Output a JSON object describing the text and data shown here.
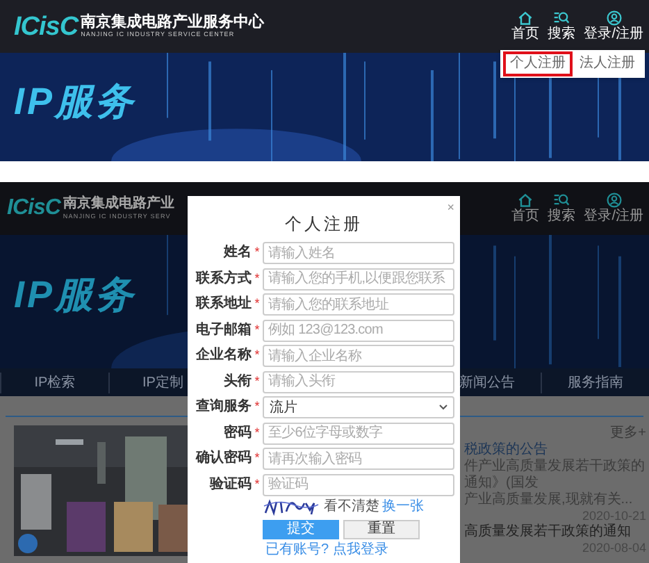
{
  "top_view": {
    "header": {
      "logo_mark": "ICisC",
      "logo_title": "南京集成电路产业服务中心",
      "logo_subtitle": "NANJING IC INDUSTRY SERVICE CENTER",
      "nav": [
        {
          "label": "首页",
          "kind": "home"
        },
        {
          "label": "搜索",
          "kind": "search"
        },
        {
          "label": "登录/注册",
          "kind": "user"
        }
      ]
    },
    "banner": {
      "title": "IP服务"
    },
    "register_menu": [
      {
        "label": "个人注册",
        "highlighted": true
      },
      {
        "label": "法人注册",
        "highlighted": false
      }
    ]
  },
  "bottom_view": {
    "header": {
      "logo_mark": "ICisC",
      "logo_title": "南京集成电路产业",
      "logo_subtitle": "NANJING IC INDUSTRY SERV",
      "nav": [
        {
          "label": "首页",
          "kind": "home"
        },
        {
          "label": "搜索",
          "kind": "search"
        },
        {
          "label": "登录/注册",
          "kind": "user"
        }
      ]
    },
    "banner": {
      "title": "IP服务"
    },
    "tabs": [
      {
        "label": "IP检索"
      },
      {
        "label": "IP定制"
      },
      {
        "label": "新闻公告"
      },
      {
        "label": "服务指南"
      }
    ],
    "more_link": "更多+",
    "news": [
      {
        "title": "税政策的公告",
        "lines": [
          "件产业高质量发展若干政策的通知》(国发",
          "产业高质量发展,现就有关..."
        ],
        "date": "2020-10-21"
      },
      {
        "title": "高质量发展若干政策的通知",
        "date": "2020-08-04"
      }
    ],
    "dialog": {
      "close": "×",
      "title": "个人注册",
      "required_mark": "*",
      "fields": [
        {
          "label": "姓名",
          "required": true,
          "kind": "text",
          "placeholder": "请输入姓名"
        },
        {
          "label": "联系方式",
          "required": true,
          "kind": "text",
          "placeholder": "请输入您的手机,以便跟您联系"
        },
        {
          "label": "联系地址",
          "required": true,
          "kind": "text",
          "placeholder": "请输入您的联系地址"
        },
        {
          "label": "电子邮箱",
          "required": true,
          "kind": "text",
          "placeholder": "例如 123@123.com"
        },
        {
          "label": "企业名称",
          "required": true,
          "kind": "text",
          "placeholder": "请输入企业名称"
        },
        {
          "label": "头衔",
          "required": true,
          "kind": "text",
          "placeholder": "请输入头衔"
        },
        {
          "label": "查询服务",
          "required": true,
          "kind": "select",
          "value": "流片"
        },
        {
          "label": "密码",
          "required": true,
          "kind": "text",
          "placeholder": "至少6位字母或数字"
        },
        {
          "label": "确认密码",
          "required": true,
          "kind": "text",
          "placeholder": "请再次输入密码"
        },
        {
          "label": "验证码",
          "required": true,
          "kind": "text",
          "placeholder": "验证码"
        }
      ],
      "captcha_hint": "看不清楚",
      "captcha_refresh": "换一张",
      "buttons": [
        {
          "label": "提交",
          "kind": "primary"
        },
        {
          "label": "重置",
          "kind": "secondary"
        }
      ],
      "login_link": "已有账号? 点我登录"
    }
  }
}
